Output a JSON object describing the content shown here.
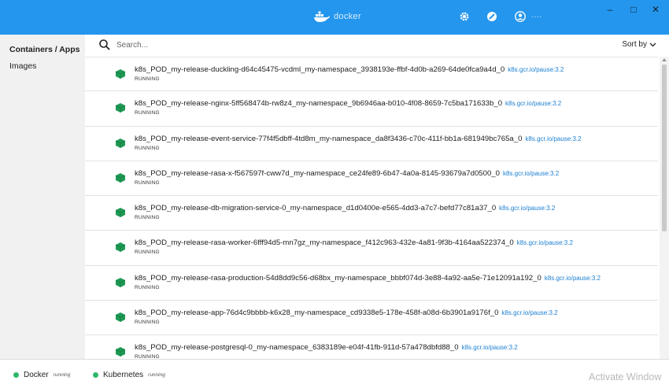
{
  "titlebar": {
    "brand": "docker",
    "user_name": "····",
    "icons": [
      "gear-icon",
      "whale-bug-icon",
      "user-icon"
    ],
    "window_controls": {
      "minimize": "–",
      "maximize": "□",
      "close": "✕"
    }
  },
  "sidebar": {
    "items": [
      {
        "label": "Containers / Apps",
        "active": true
      },
      {
        "label": "Images",
        "active": false
      }
    ]
  },
  "search": {
    "placeholder": "Search...",
    "value": ""
  },
  "sort": {
    "label": "Sort by"
  },
  "containers": [
    {
      "name": "k8s_POD_my-release-duckling-d64c45475-vcdml_my-namespace_3938193e-ffbf-4d0b-a269-64de0fca9a4d_0",
      "image": "k8s.gcr.io/pause:3.2",
      "status": "RUNNING"
    },
    {
      "name": "k8s_POD_my-release-nginx-5ff568474b-rw8z4_my-namespace_9b6946aa-b010-4f08-8659-7c5ba171633b_0",
      "image": "k8s.gcr.io/pause:3.2",
      "status": "RUNNING"
    },
    {
      "name": "k8s_POD_my-release-event-service-77f4f5dbff-4td8m_my-namespace_da8f3436-c70c-411f-bb1a-681949bc765a_0",
      "image": "k8s.gcr.io/pause:3.2",
      "status": "RUNNING"
    },
    {
      "name": "k8s_POD_my-release-rasa-x-f567597f-cww7d_my-namespace_ce24fe89-6b47-4a0a-8145-93679a7d0500_0",
      "image": "k8s.gcr.io/pause:3.2",
      "status": "RUNNING"
    },
    {
      "name": "k8s_POD_my-release-db-migration-service-0_my-namespace_d1d0400e-e565-4dd3-a7c7-befd77c81a37_0",
      "image": "k8s.gcr.io/pause:3.2",
      "status": "RUNNING"
    },
    {
      "name": "k8s_POD_my-release-rasa-worker-6fff94d5-mn7gz_my-namespace_f412c963-432e-4a81-9f3b-4164aa522374_0",
      "image": "k8s.gcr.io/pause:3.2",
      "status": "RUNNING"
    },
    {
      "name": "k8s_POD_my-release-rasa-production-54d8dd9c56-d68bx_my-namespace_bbbf074d-3e88-4a92-aa5e-71e12091a192_0",
      "image": "k8s.gcr.io/pause:3.2",
      "status": "RUNNING"
    },
    {
      "name": "k8s_POD_my-release-app-76d4c9bbbb-k6x28_my-namespace_cd9338e5-178e-458f-a08d-6b3901a9176f_0",
      "image": "k8s.gcr.io/pause:3.2",
      "status": "RUNNING"
    },
    {
      "name": "k8s_POD_my-release-postgresql-0_my-namespace_6383189e-e04f-41fb-911d-57a478dbfd88_0",
      "image": "k8s.gcr.io/pause:3.2",
      "status": "RUNNING"
    }
  ],
  "footer": {
    "docker": {
      "label": "Docker",
      "status": "running"
    },
    "kubernetes": {
      "label": "Kubernetes",
      "status": "running"
    },
    "watermark": "Activate Window"
  },
  "colors": {
    "titlebar": "#2496ed",
    "running": "#2fb76b",
    "container": "#1f9a55",
    "link": "#1b7fd1"
  }
}
